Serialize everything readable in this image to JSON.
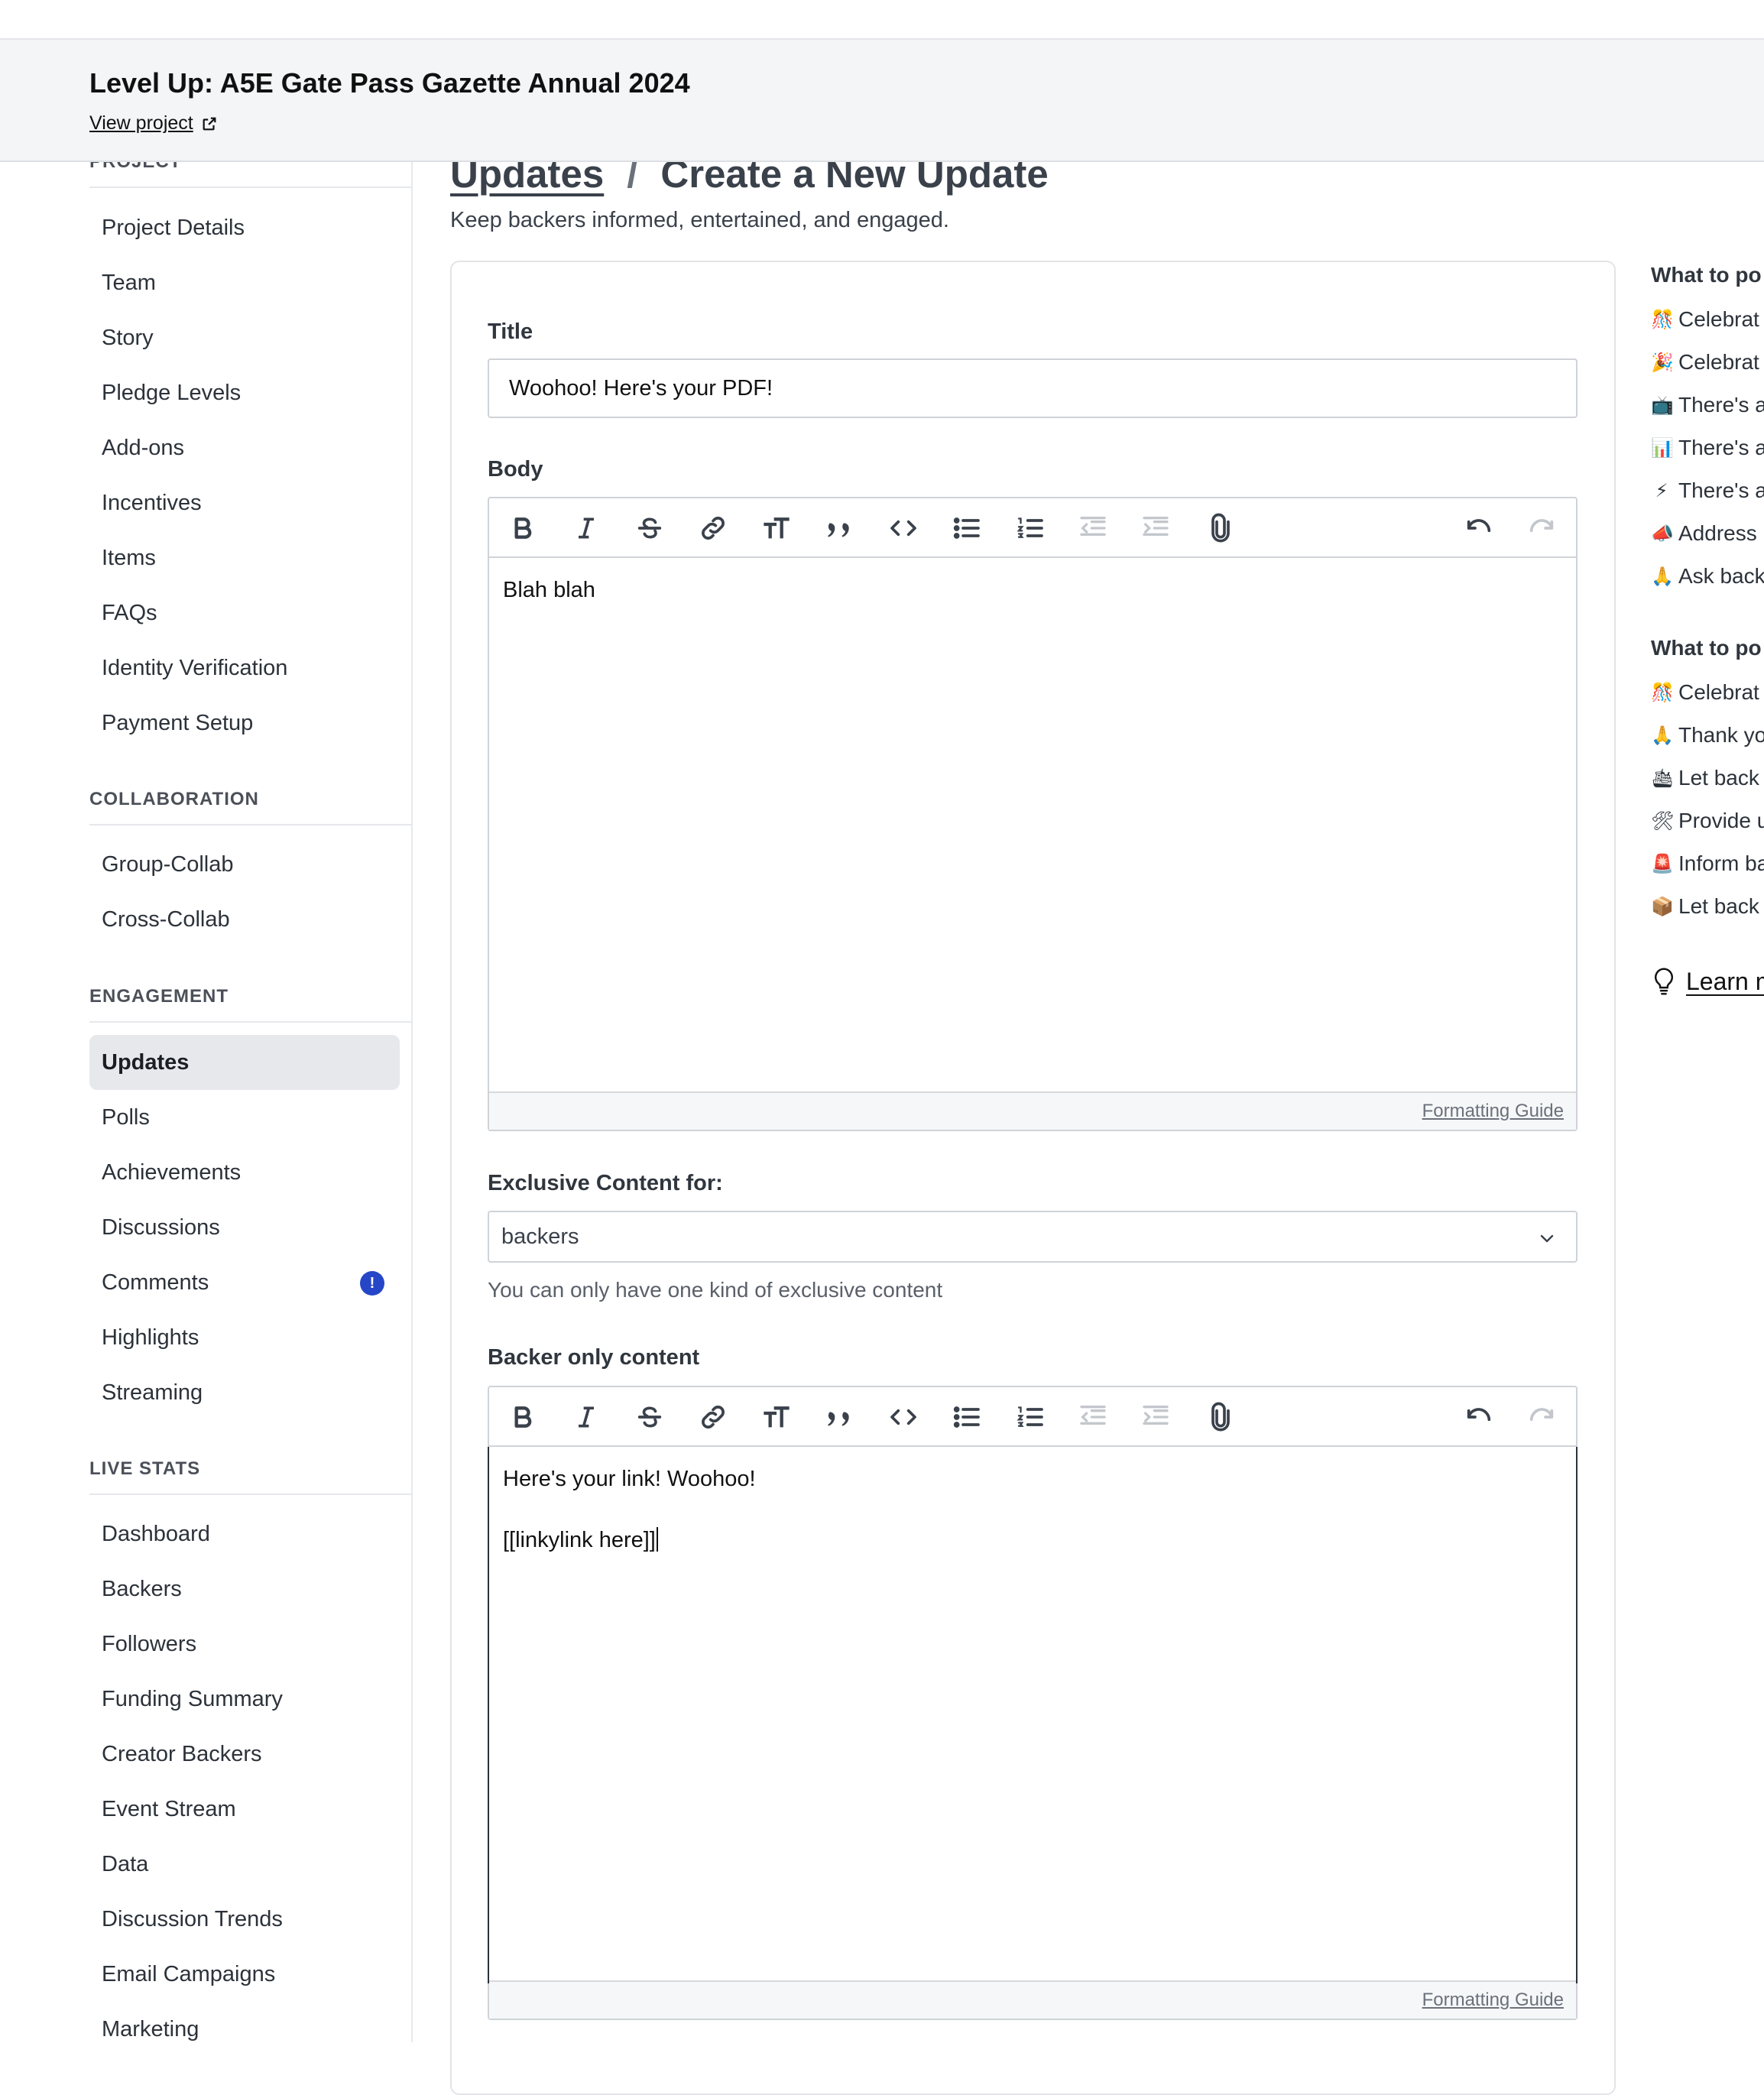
{
  "header": {
    "title": "Level Up: A5E Gate Pass Gazette Annual 2024",
    "view_project": "View project"
  },
  "sidebar": {
    "sections": [
      {
        "heading": "PROJECT",
        "items": [
          "Project Details",
          "Team",
          "Story",
          "Pledge Levels",
          "Add-ons",
          "Incentives",
          "Items",
          "FAQs",
          "Identity Verification",
          "Payment Setup"
        ]
      },
      {
        "heading": "COLLABORATION",
        "items": [
          "Group-Collab",
          "Cross-Collab"
        ]
      },
      {
        "heading": "ENGAGEMENT",
        "items": [
          "Updates",
          "Polls",
          "Achievements",
          "Discussions",
          "Comments",
          "Highlights",
          "Streaming"
        ],
        "active": "Updates",
        "badge_item": "Comments",
        "badge_text": "!"
      },
      {
        "heading": "LIVE STATS",
        "items": [
          "Dashboard",
          "Backers",
          "Followers",
          "Funding Summary",
          "Creator Backers",
          "Event Stream",
          "Data",
          "Discussion Trends",
          "Email Campaigns",
          "Marketing"
        ]
      }
    ]
  },
  "main": {
    "breadcrumb_link": "Updates",
    "breadcrumb_sep": "/",
    "breadcrumb_current": "Create a New Update",
    "subtitle": "Keep backers informed, entertained, and engaged.",
    "title_label": "Title",
    "title_value": "Woohoo! Here's your PDF!",
    "body_label": "Body",
    "body_text": "Blah blah",
    "formatting_guide": "Formatting Guide",
    "exclusive_label": "Exclusive Content for:",
    "exclusive_value": "backers",
    "exclusive_help": "You can only have one kind of exclusive content",
    "backer_label": "Backer only content",
    "backer_line1": "Here's your link! Woohoo!",
    "backer_line2": "[[linkylink here]]"
  },
  "toolbar": {
    "buttons": [
      "bold",
      "italic",
      "strikethrough",
      "link",
      "heading",
      "quote",
      "code",
      "bullet-list",
      "numbered-list",
      "decrease-indent",
      "increase-indent",
      "attach",
      "undo",
      "redo"
    ]
  },
  "tips": {
    "heading1": "What to po",
    "list1": [
      {
        "emoji": "🎊",
        "text": "Celebrat"
      },
      {
        "emoji": "🎉",
        "text": "Celebrat"
      },
      {
        "emoji": "📺",
        "text": "There's a"
      },
      {
        "emoji": "📊",
        "text": "There's a"
      },
      {
        "emoji": "⚡",
        "text": "There's a"
      },
      {
        "emoji": "📣",
        "text": "Address"
      },
      {
        "emoji": "🙏",
        "text": "Ask back"
      }
    ],
    "heading2": "What to po",
    "list2": [
      {
        "emoji": "🎊",
        "text": "Celebrat"
      },
      {
        "emoji": "🙏",
        "text": "Thank yo"
      },
      {
        "emoji": "🛳",
        "text": "Let back"
      },
      {
        "emoji": "🛠",
        "text": "Provide u"
      },
      {
        "emoji": "🚨",
        "text": "Inform ba"
      },
      {
        "emoji": "📦",
        "text": "Let back"
      }
    ],
    "learn": "Learn m"
  }
}
